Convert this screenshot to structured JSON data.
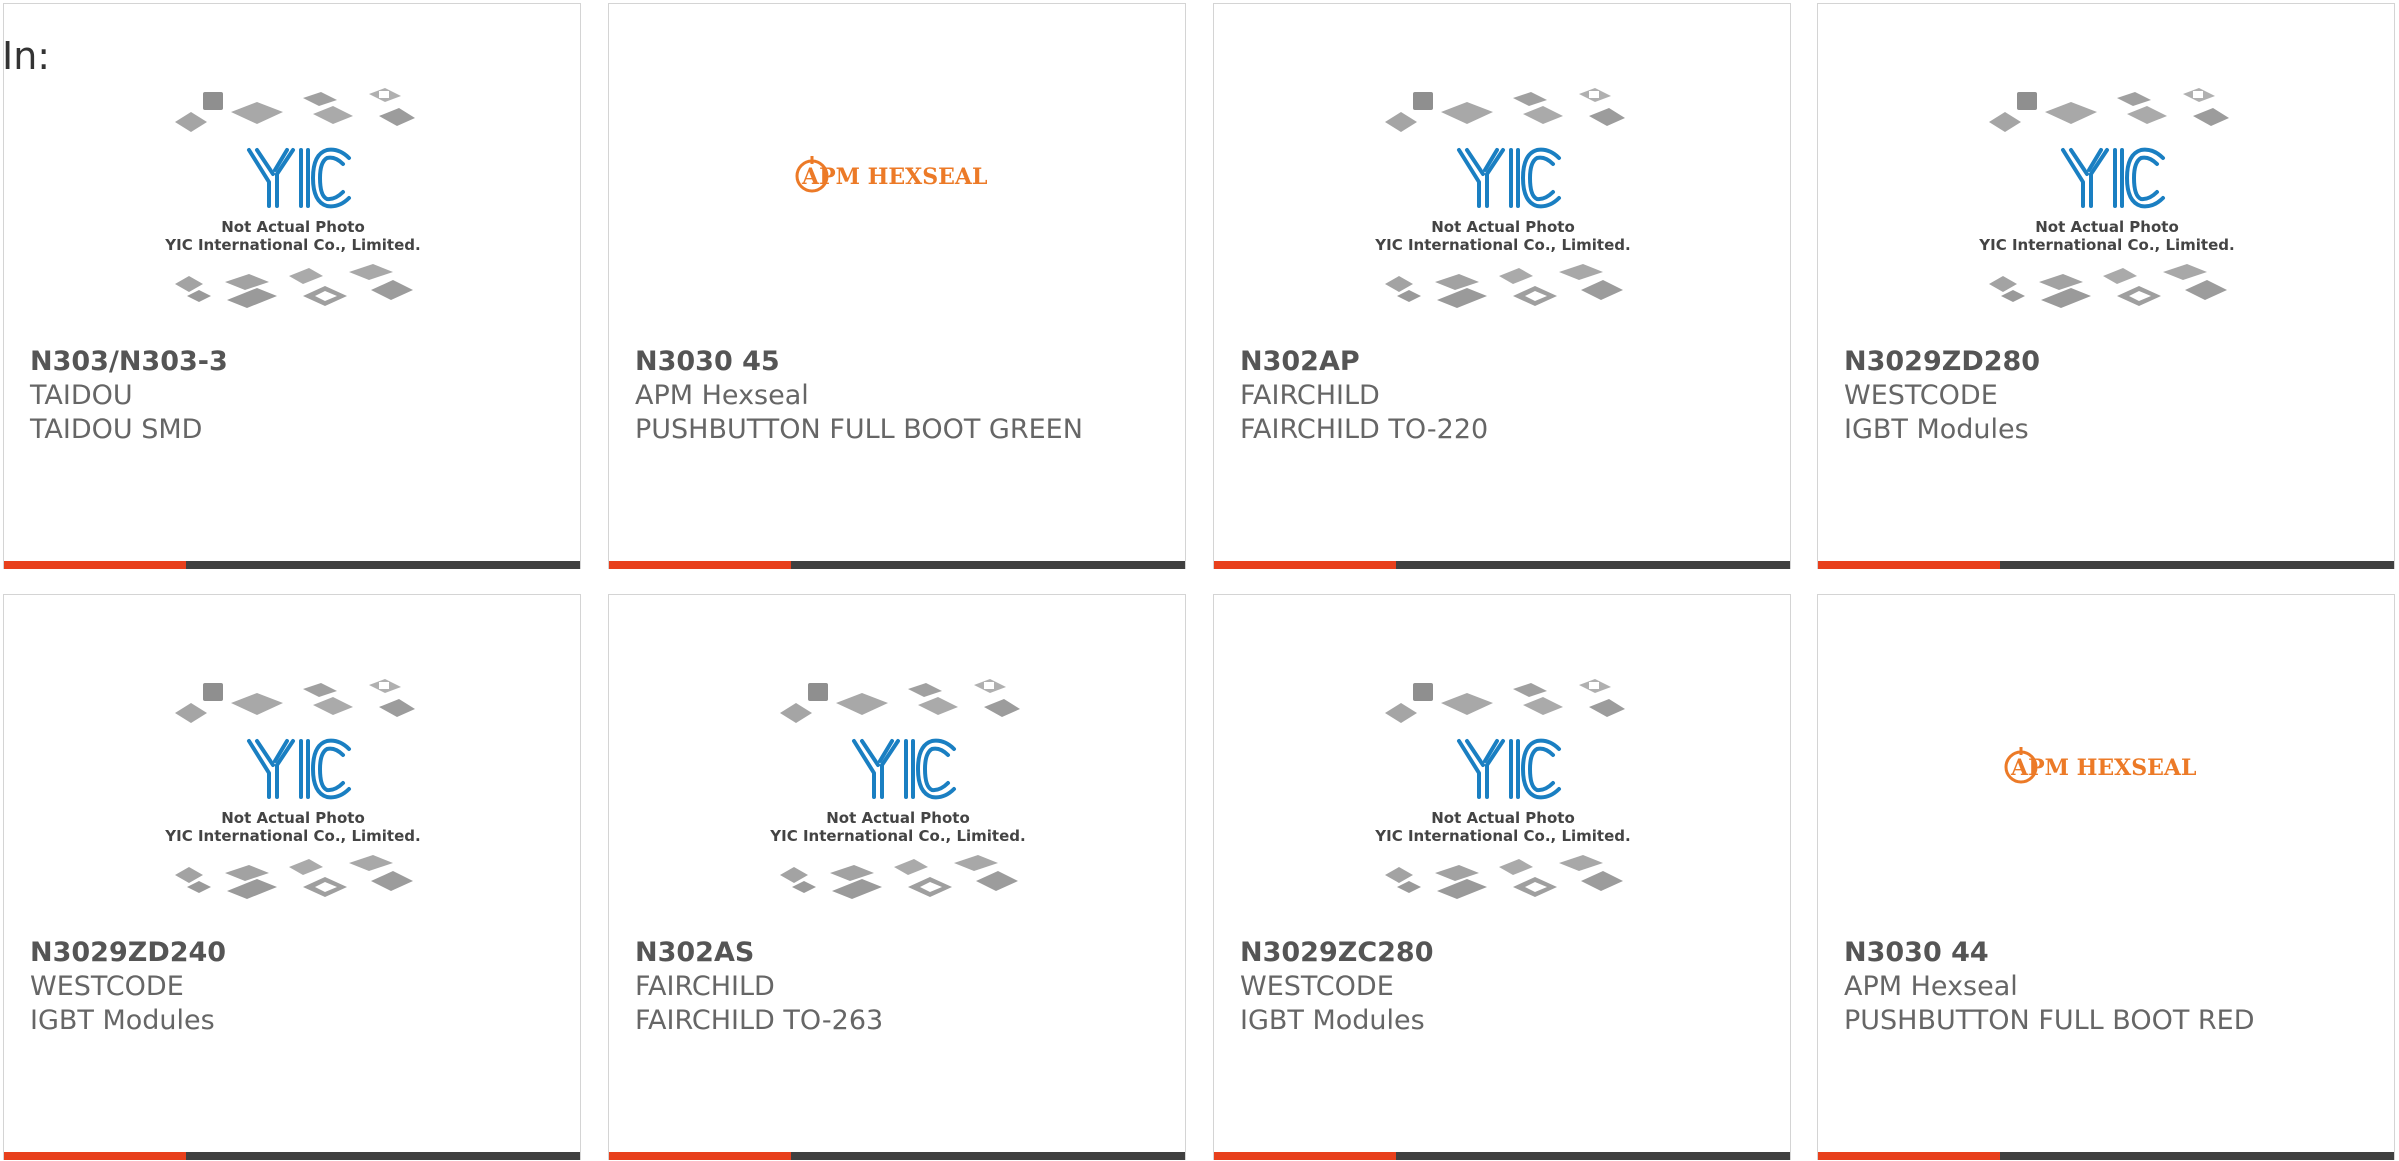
{
  "header": {
    "in_label": "In:"
  },
  "colors": {
    "accent": "#e8401c",
    "bar": "#404040",
    "yic_blue": "#1a7fc2",
    "apm_orange": "#ec7a27"
  },
  "placeholder": {
    "line1": "Not Actual Photo",
    "line2": "YIC International Co., Limited.",
    "logo": "YIC"
  },
  "apm_logo": {
    "text": "APM HEXSEAL"
  },
  "products": [
    {
      "part": "N303/N303-3",
      "manufacturer": "TAIDOU",
      "description": "TAIDOU SMD",
      "image": "yic-placeholder"
    },
    {
      "part": "N3030 45",
      "manufacturer": "APM Hexseal",
      "description": "PUSHBUTTON FULL BOOT GREEN",
      "image": "apm-hexseal-logo"
    },
    {
      "part": "N302AP",
      "manufacturer": "FAIRCHILD",
      "description": "FAIRCHILD TO-220",
      "image": "yic-placeholder"
    },
    {
      "part": "N3029ZD280",
      "manufacturer": "WESTCODE",
      "description": "IGBT Modules",
      "image": "yic-placeholder"
    },
    {
      "part": "N3029ZD240",
      "manufacturer": "WESTCODE",
      "description": "IGBT Modules",
      "image": "yic-placeholder"
    },
    {
      "part": "N302AS",
      "manufacturer": "FAIRCHILD",
      "description": "FAIRCHILD TO-263",
      "image": "yic-placeholder"
    },
    {
      "part": "N3029ZC280",
      "manufacturer": "WESTCODE",
      "description": "IGBT Modules",
      "image": "yic-placeholder"
    },
    {
      "part": "N3030 44",
      "manufacturer": "APM Hexseal",
      "description": "PUSHBUTTON FULL BOOT RED",
      "image": "apm-hexseal-logo"
    }
  ]
}
